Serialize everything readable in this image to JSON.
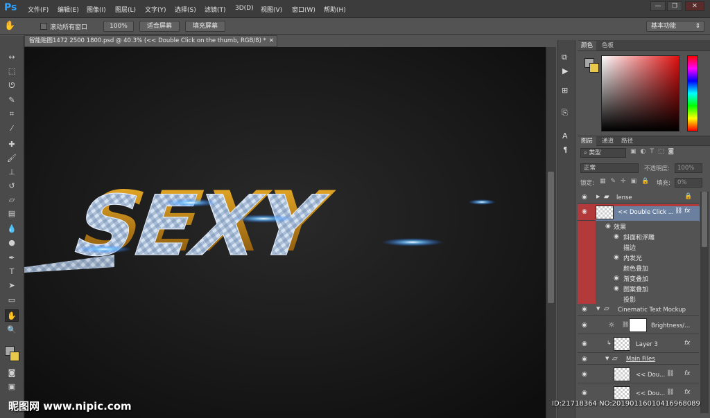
{
  "app": {
    "logo": "Ps"
  },
  "menu": [
    "文件(F)",
    "编辑(E)",
    "图像(I)",
    "图层(L)",
    "文字(Y)",
    "选择(S)",
    "滤镜(T)",
    "3D(D)",
    "视图(V)",
    "窗口(W)",
    "帮助(H)"
  ],
  "window_buttons": {
    "minimize": "—",
    "restore": "❐",
    "close": "✕"
  },
  "options": {
    "scroll_all_label": "滚动所有窗口",
    "zoom_100": "100%",
    "fit_screen": "适合屏幕",
    "fill_screen": "填充屏幕",
    "workspace": "基本功能"
  },
  "document": {
    "tab_title": "智能贴图1472 2500 1800.psd @ 40.3% (<< Double Click on the thumb, RGB/8) *",
    "close": "✕"
  },
  "canvas": {
    "art_text": "SEXY"
  },
  "color_panel": {
    "tabs": [
      "颜色",
      "色板"
    ]
  },
  "layers_panel": {
    "tabs": [
      "图层",
      "通道",
      "路径"
    ],
    "filter_label": "类型",
    "blend_mode": "正常",
    "opacity_label": "不透明度:",
    "opacity_value": "100%",
    "lock_label": "锁定:",
    "fill_label": "填充:",
    "fill_value": "0%",
    "layers": [
      {
        "name": "lense",
        "kind": "group"
      },
      {
        "name": "<< Double Click ...",
        "kind": "smart",
        "fx": "fx"
      },
      {
        "name": "Cinematic Text Mockup",
        "kind": "group"
      },
      {
        "name": "Brightness/...",
        "kind": "adjustment"
      },
      {
        "name": "Layer 3",
        "kind": "layer",
        "fx": "fx"
      },
      {
        "name": "Main Files",
        "kind": "group"
      },
      {
        "name": "<< Dou...",
        "kind": "smart",
        "fx": "fx"
      },
      {
        "name": "<< Dou...",
        "kind": "smart",
        "fx": "fx"
      }
    ],
    "effects_header": "效果",
    "effects": [
      "斜面和浮雕",
      "描边",
      "内发光",
      "颜色叠加",
      "渐变叠加",
      "图案叠加",
      "投影"
    ]
  },
  "watermark": {
    "left": "昵图网 www.nipic.com",
    "right": "ID:21718364 NO:20190116010416968089"
  },
  "colors": {
    "accent_selected": "#b33a3a",
    "ps_blue": "#2fa3ff",
    "fg_swatch": "#a8a8a8",
    "bg_swatch": "#e8c84a"
  }
}
